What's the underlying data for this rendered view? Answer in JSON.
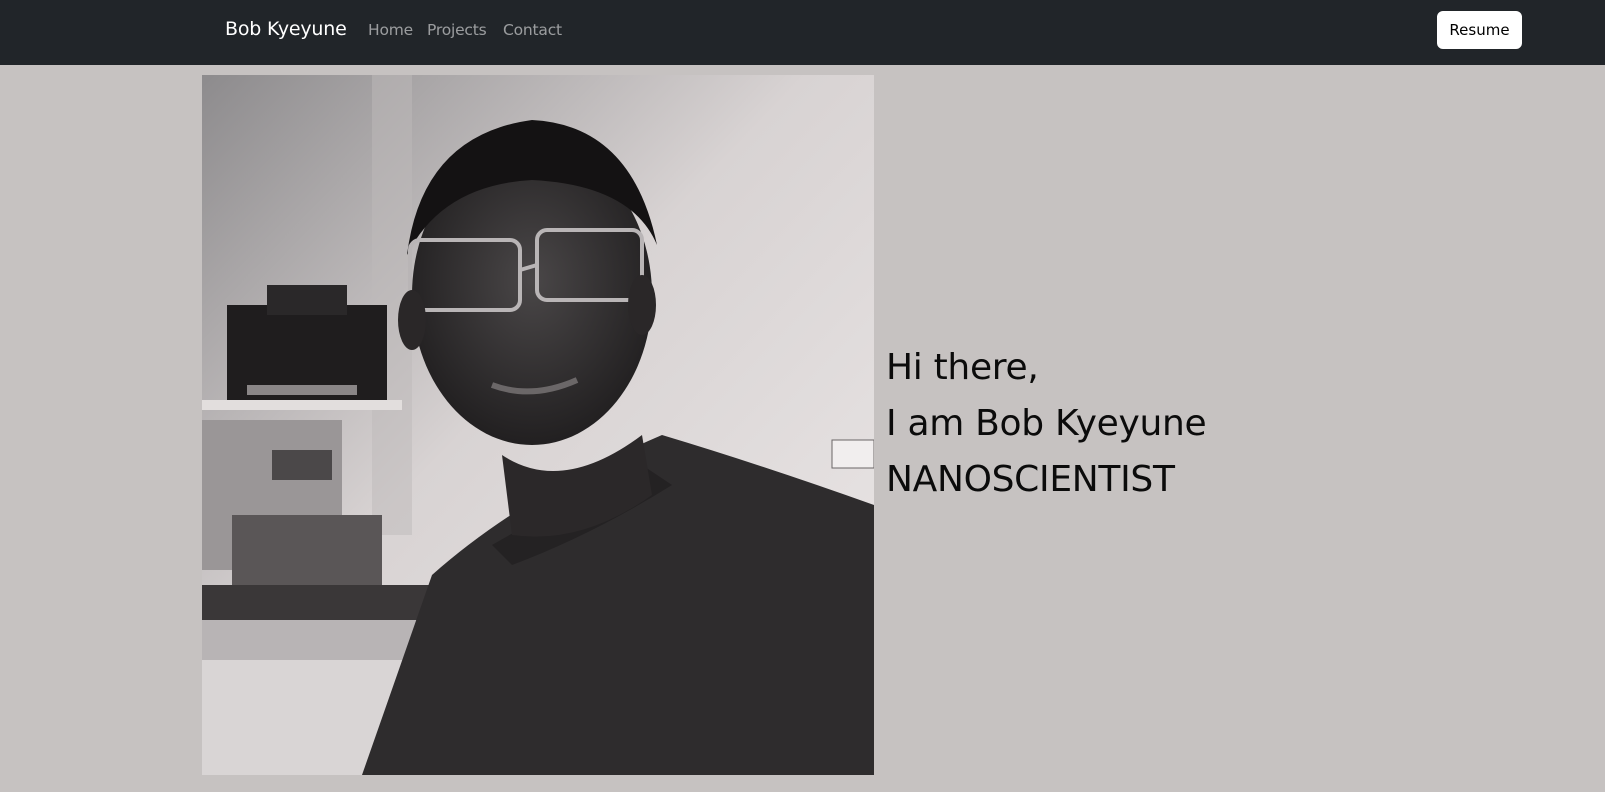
{
  "navbar": {
    "brand": "Bob Kyeyune",
    "links": [
      {
        "label": "Home"
      },
      {
        "label": "Projects"
      },
      {
        "label": "Contact"
      }
    ],
    "resume_button": "Resume"
  },
  "hero": {
    "greeting": "Hi there,",
    "name_line": "I am Bob Kyeyune",
    "title_line": "NANOSCIENTIST"
  },
  "colors": {
    "navbar_bg": "#212529",
    "page_bg": "#c6c2c1"
  }
}
